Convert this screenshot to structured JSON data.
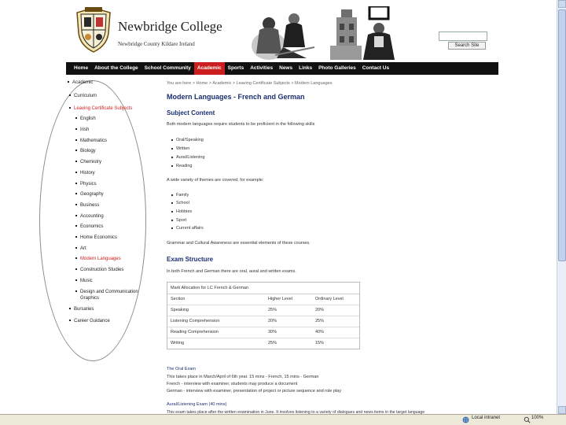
{
  "header": {
    "college_name": "Newbridge College",
    "address": "Newbridge County Kildare Ireland",
    "search_button": "Search Site"
  },
  "nav": [
    "Home",
    "About the College",
    "School Community",
    "Academic",
    "Sports",
    "Activities",
    "News",
    "Links",
    "Photo Galleries",
    "Contact Us"
  ],
  "nav_active": "Academic",
  "sidebar": {
    "top": "Academic",
    "curriculum": "Curriculum",
    "lc_subjects": "Leaving Certificate Subjects",
    "subjects": [
      "English",
      "Irish",
      "Mathematics",
      "Biology",
      "Chemistry",
      "History",
      "Physics",
      "Geography",
      "Business",
      "Accounting",
      "Economics",
      "Home Economics",
      "Art",
      "Modern Languages",
      "Construction Studies",
      "Music",
      "Design and Communication",
      "Graphics"
    ],
    "active_subject": "Modern Languages",
    "bottom": [
      "Bursaries",
      "Career Guidance"
    ]
  },
  "main": {
    "breadcrumb": "You are here > Home > Academic > Leaving Certificate Subjects > Modern Languages",
    "title": "Modern Languages - French and German",
    "subject_content_heading": "Subject Content",
    "skills_intro": "Both modern languages require students to be proficient in the following skills",
    "skills": [
      "Oral/Speaking",
      "Written",
      "Aural/Listening",
      "Reading"
    ],
    "themes_intro": "A wide variety of themes are covered, for example:",
    "themes": [
      "Family",
      "School",
      "Hobbies",
      "Sport",
      "Current affairs"
    ],
    "awareness": "Grammar and Cultural Awareness are essential elements of these courses.",
    "exam_heading": "Exam Structure",
    "exam_intro": "In both French and German there are oral, aural and written exams.",
    "table": {
      "caption": "Mark Allocation for LC French & German",
      "headers": [
        "Section",
        "Higher Level",
        "Ordinary Level"
      ],
      "rows": [
        [
          "Speaking",
          "25%",
          "20%"
        ],
        [
          "Listening Comprehension",
          "20%",
          "25%"
        ],
        [
          "Reading Comprehension",
          "30%",
          "40%"
        ],
        [
          "Writing",
          "25%",
          "15%"
        ]
      ]
    },
    "oral_heading": "The Oral Exam",
    "oral_lines": [
      "This takes place in March/April of 6th year.  15 mins - French, 15 mins - German",
      "French - interview with examiner, students may produce a document",
      "German - interview with examiner, presentation of project or picture sequence and role play"
    ],
    "aural_heading": "Aural/Listening Exam (40 mins)",
    "aural_line": "This exam takes place after the written examination in June. It involves listening to a variety of dialogues and news items in the target language"
  },
  "status": {
    "zone": "Local intranet",
    "zoom": "100%"
  }
}
